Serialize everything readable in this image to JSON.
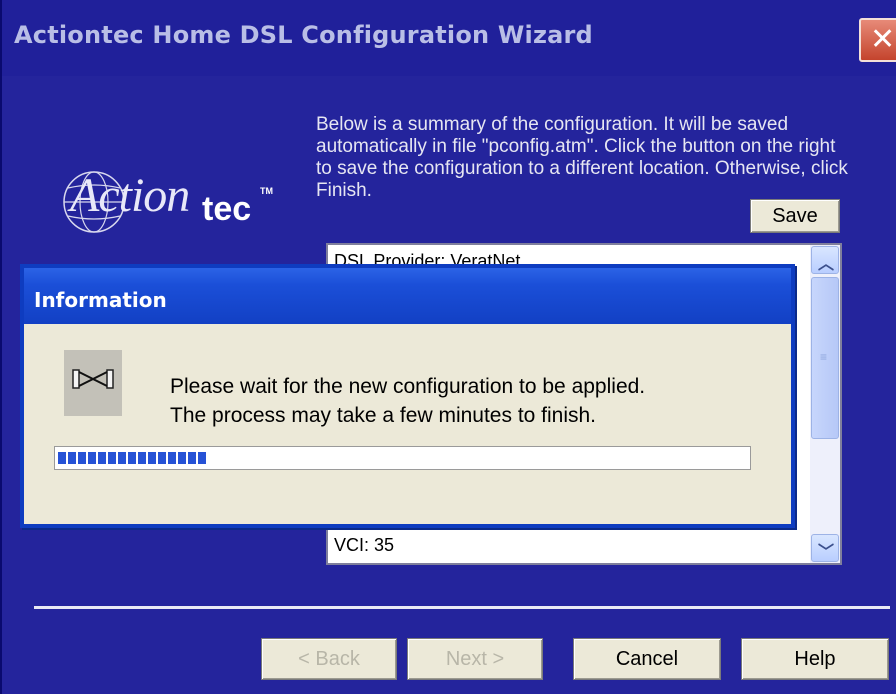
{
  "window": {
    "title": "Actiontec Home DSL Configuration Wizard",
    "close_glyph": "✕"
  },
  "logo": {
    "script": "Actiontec",
    "name_part1": "Action",
    "name_part2": "tec",
    "tm": "TM"
  },
  "description": "Below is a summary of the configuration. It will be saved automatically in file \"pconfig.atm\". Click the button on the right to save the configuration to a different location. Otherwise, click Finish.",
  "buttons": {
    "save": "Save",
    "back": "< Back",
    "next": "Next >",
    "cancel": "Cancel",
    "help": "Help"
  },
  "summary_list": {
    "items": [
      "DSL Provider: VeratNet",
      "VCI: 35"
    ]
  },
  "dialog": {
    "title": "Information",
    "message_line1": "Please wait for the new configuration to be applied.",
    "message_line2": "The process may take a few minutes to finish.",
    "progress_fraction": 0.22
  },
  "colors": {
    "wizard_background": "#24249c",
    "dialog_title_bar": "#1b4fd8",
    "progress_fill": "#2652d6"
  },
  "icons": {
    "dialog_icon": "network-connection-icon",
    "close": "close-icon"
  }
}
